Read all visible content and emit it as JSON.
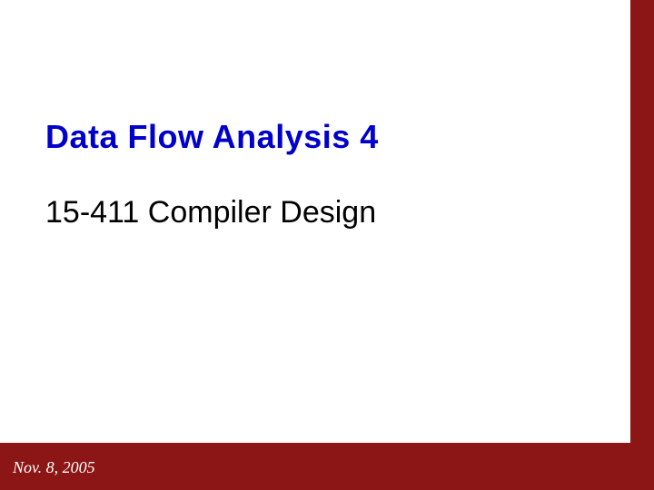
{
  "slide": {
    "title": "Data Flow Analysis 4",
    "subtitle": "15-411 Compiler Design",
    "date": "Nov. 8, 2005"
  }
}
